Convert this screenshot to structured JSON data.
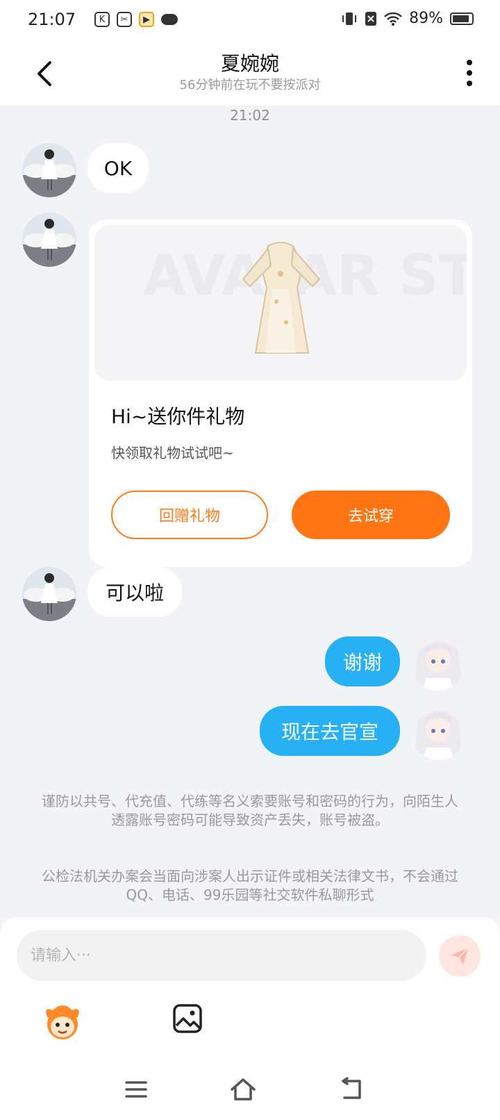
{
  "status_bar": {
    "time": "21:07",
    "battery_percent": "89%",
    "battery_level": 0.89
  },
  "header": {
    "title": "夏婉婉",
    "subtitle": "56分钟前在玩不要按派对"
  },
  "chat": {
    "timestamp": "21:02",
    "messages": [
      {
        "from": "other",
        "text": "OK"
      },
      {
        "from": "other",
        "text": "可以啦"
      },
      {
        "from": "me",
        "text": "谢谢"
      },
      {
        "from": "me",
        "text": "现在去官宣"
      }
    ],
    "gift_card": {
      "watermark": "AVATAR STORE",
      "title": "Hi~送你件礼物",
      "description": "快领取礼物试试吧~",
      "return_gift_label": "回赠礼物",
      "try_on_label": "去试穿"
    },
    "notices": [
      "谨防以共号、代充值、代练等名义索要账号和密码的行为，向陌生人透露账号密码可能导致资产丢失，账号被盗。",
      "公检法机关办案会当面向涉案人出示证件或相关法律文书，不会通过QQ、电话、99乐园等社交软件私聊形式"
    ]
  },
  "input_bar": {
    "placeholder": "请输入···"
  },
  "colors": {
    "accent_orange": "#ff7513",
    "bubble_blue": "#27b0f4",
    "background": "#f2f3f7"
  }
}
